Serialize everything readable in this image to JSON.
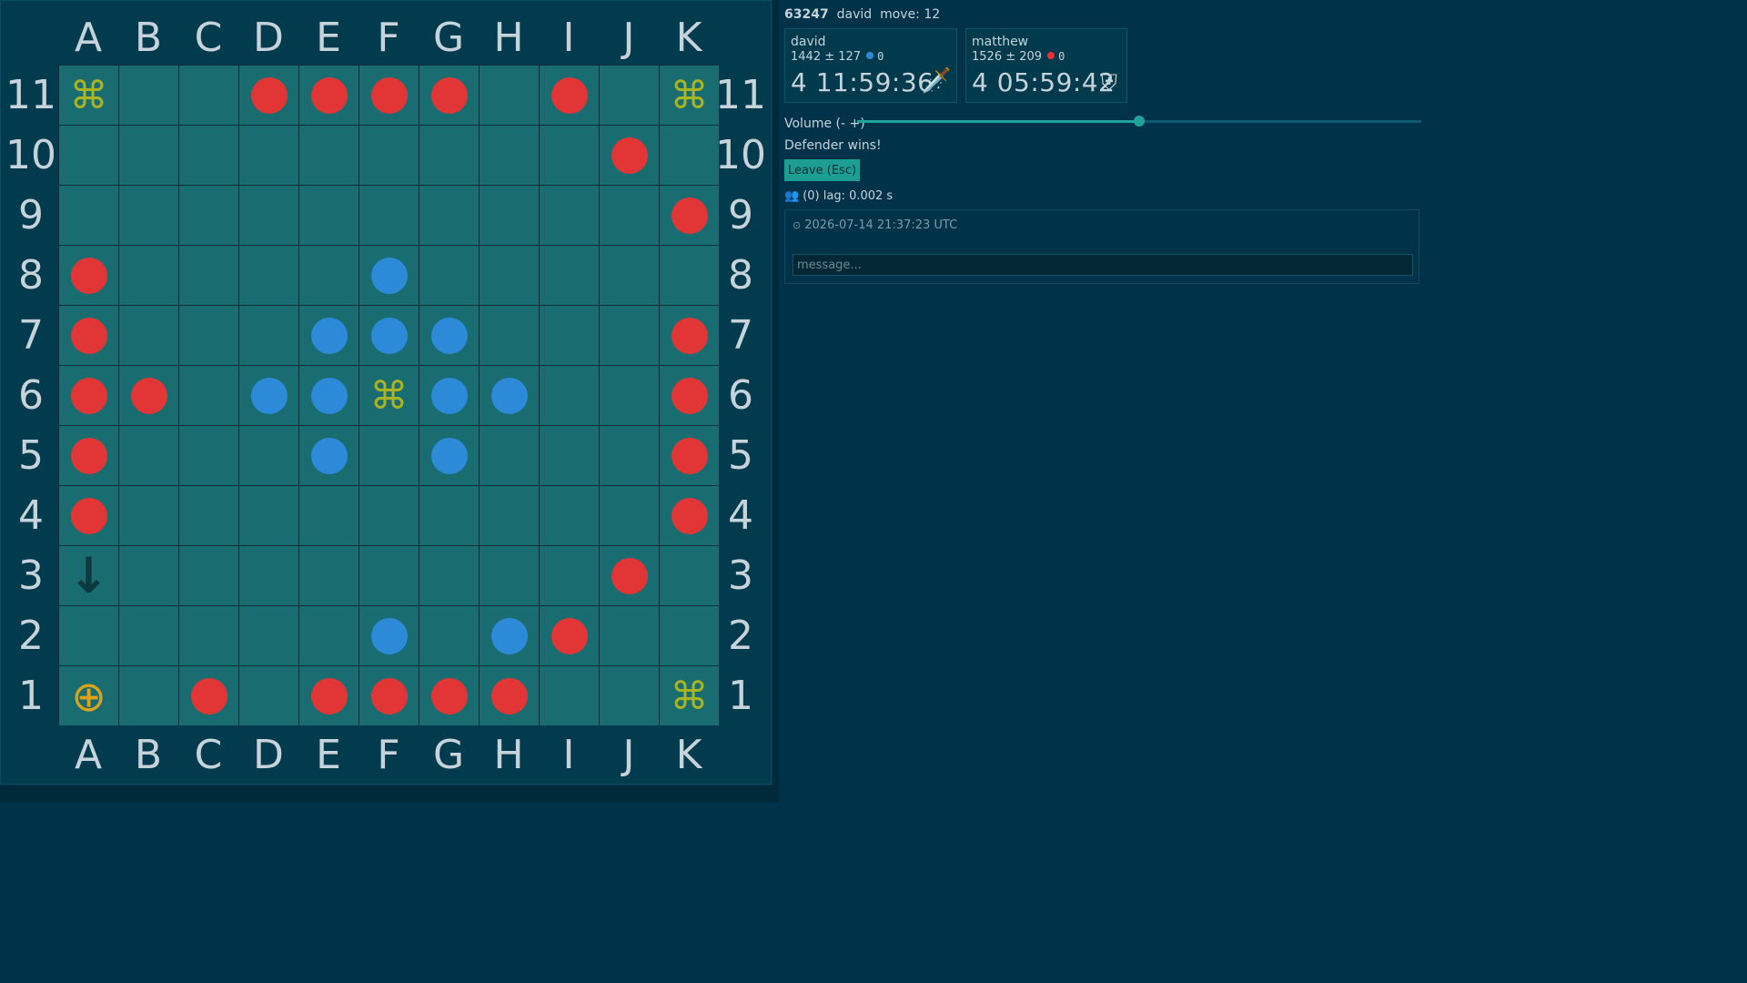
{
  "board": {
    "files": [
      "A",
      "B",
      "C",
      "D",
      "E",
      "F",
      "G",
      "H",
      "I",
      "J",
      "K"
    ],
    "ranks": [
      "11",
      "10",
      "9",
      "8",
      "7",
      "6",
      "5",
      "4",
      "3",
      "2",
      "1"
    ],
    "attacker_color": "#e23636",
    "defender_color": "#2d8ad9",
    "cells": {
      "A11": "restricted",
      "K11": "restricted",
      "F6": "restricted",
      "K1": "restricted",
      "A1": "king",
      "A3": "arrow",
      "D11": "attacker",
      "E11": "attacker",
      "F11": "attacker",
      "G11": "attacker",
      "I11": "attacker",
      "J10": "attacker",
      "K9": "attacker",
      "A8": "attacker",
      "F8": "defender",
      "A7": "attacker",
      "E7": "defender",
      "F7": "defender",
      "G7": "defender",
      "K7": "attacker",
      "A6": "attacker",
      "B6": "attacker",
      "D6": "defender",
      "E6": "defender",
      "G6": "defender",
      "H6": "defender",
      "K6": "attacker",
      "A5": "attacker",
      "E5": "defender",
      "G5": "defender",
      "K5": "attacker",
      "A4": "attacker",
      "K4": "attacker",
      "J3": "attacker",
      "F2": "defender",
      "H2": "defender",
      "I2": "attacker",
      "C1": "attacker",
      "E1": "attacker",
      "F1": "attacker",
      "G1": "attacker",
      "H1": "attacker"
    },
    "glyphs": {
      "restricted": "⌘",
      "king": "⊕",
      "arrow": "↓"
    }
  },
  "header": {
    "game_id": "63247",
    "user": "david",
    "move_text": "move: 12"
  },
  "players": [
    {
      "name": "david",
      "rating": "1442  ±  127",
      "side_color": "#2d8ad9",
      "captures": "0",
      "clock": "4 11:59:36",
      "role_icon": "dagger-icon",
      "role_glyph": "🗡️"
    },
    {
      "name": "matthew",
      "rating": "1526  ±  209",
      "side_color": "#e23636",
      "captures": "0",
      "clock": "4 05:59:42",
      "role_icon": "shield-icon",
      "role_glyph": "⛨"
    }
  ],
  "volume": {
    "label": "Volume (- +)",
    "level": 0.5
  },
  "status": "Defender wins!",
  "leave_button": "Leave (Esc)",
  "users": {
    "icon": "users-icon",
    "text": "(0) lag: 0.002 s"
  },
  "chat": {
    "timestamp": "2026-07-14 21:37:23 UTC",
    "placeholder": "message..."
  }
}
